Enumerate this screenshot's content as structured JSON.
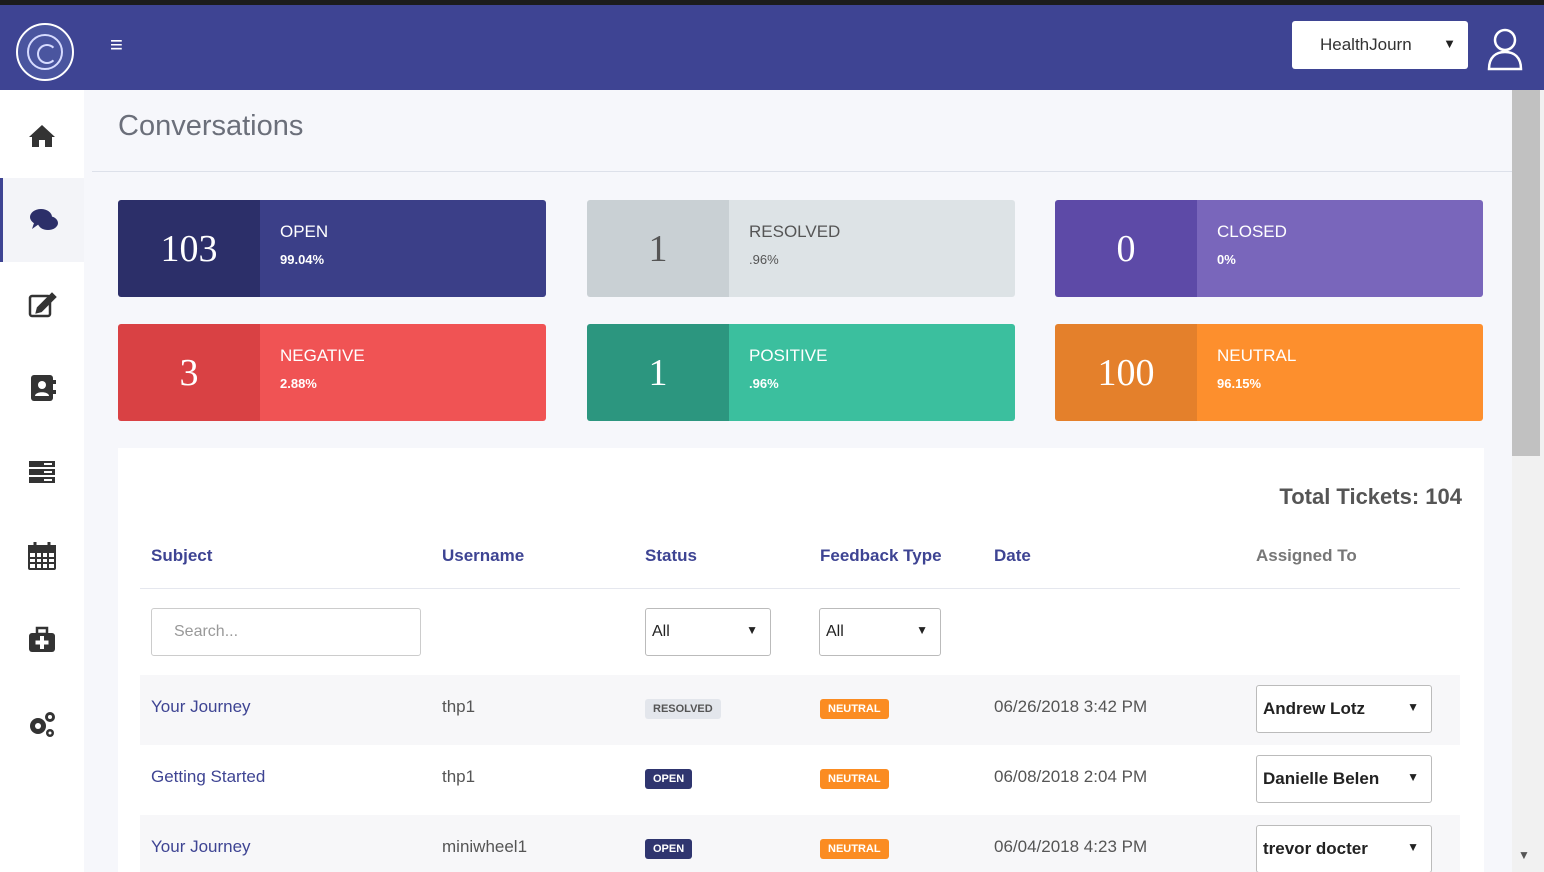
{
  "topbar": {
    "org_select_value": "HealthJourn",
    "colors": {
      "bar": "#3e4493"
    }
  },
  "sidebar": {
    "items": [
      {
        "icon": "home-icon",
        "active": false
      },
      {
        "icon": "chat-icon",
        "active": true
      },
      {
        "icon": "edit-icon",
        "active": false
      },
      {
        "icon": "contacts-icon",
        "active": false
      },
      {
        "icon": "list-icon",
        "active": false
      },
      {
        "icon": "calendar-icon",
        "active": false
      },
      {
        "icon": "medkit-icon",
        "active": false
      },
      {
        "icon": "settings-icon",
        "active": false
      }
    ]
  },
  "page": {
    "title": "Conversations"
  },
  "stats": [
    {
      "value": "103",
      "label": "OPEN",
      "pct": "99.04%",
      "color_num": "#2c2f69",
      "color_info": "#3b3f88",
      "text": "#ffffff"
    },
    {
      "value": "1",
      "label": "RESOLVED",
      "pct": ".96%",
      "color_num": "#c9d0d4",
      "color_info": "#dde3e6",
      "text": "#555555"
    },
    {
      "value": "0",
      "label": "CLOSED",
      "pct": "0%",
      "color_num": "#5d4aa7",
      "color_info": "#7966bb",
      "text": "#ffffff"
    },
    {
      "value": "3",
      "label": "NEGATIVE",
      "pct": "2.88%",
      "color_num": "#d94144",
      "color_info": "#f05354",
      "text": "#ffffff"
    },
    {
      "value": "1",
      "label": "POSITIVE",
      "pct": ".96%",
      "color_num": "#2c967f",
      "color_info": "#3bbf9e",
      "text": "#ffffff"
    },
    {
      "value": "100",
      "label": "NEUTRAL",
      "pct": "96.15%",
      "color_num": "#e4802b",
      "color_info": "#fd8f2d",
      "text": "#ffffff"
    }
  ],
  "table": {
    "total_label": "Total Tickets: 104",
    "headers": [
      "Subject",
      "Username",
      "Status",
      "Feedback Type",
      "Date",
      "Assigned To"
    ],
    "search_placeholder": "Search...",
    "status_filter": "All",
    "feedback_filter": "All",
    "rows": [
      {
        "subject": "Your Journey",
        "username": "thp1",
        "status": "RESOLVED",
        "feedback": "NEUTRAL",
        "date": "06/26/2018 3:42 PM",
        "assigned": "Andrew Lotz"
      },
      {
        "subject": "Getting Started",
        "username": "thp1",
        "status": "OPEN",
        "feedback": "NEUTRAL",
        "date": "06/08/2018 2:04 PM",
        "assigned": "Danielle Belen"
      },
      {
        "subject": "Your Journey",
        "username": "miniwheel1",
        "status": "OPEN",
        "feedback": "NEUTRAL",
        "date": "06/04/2018 4:23 PM",
        "assigned": "trevor docter"
      }
    ]
  }
}
